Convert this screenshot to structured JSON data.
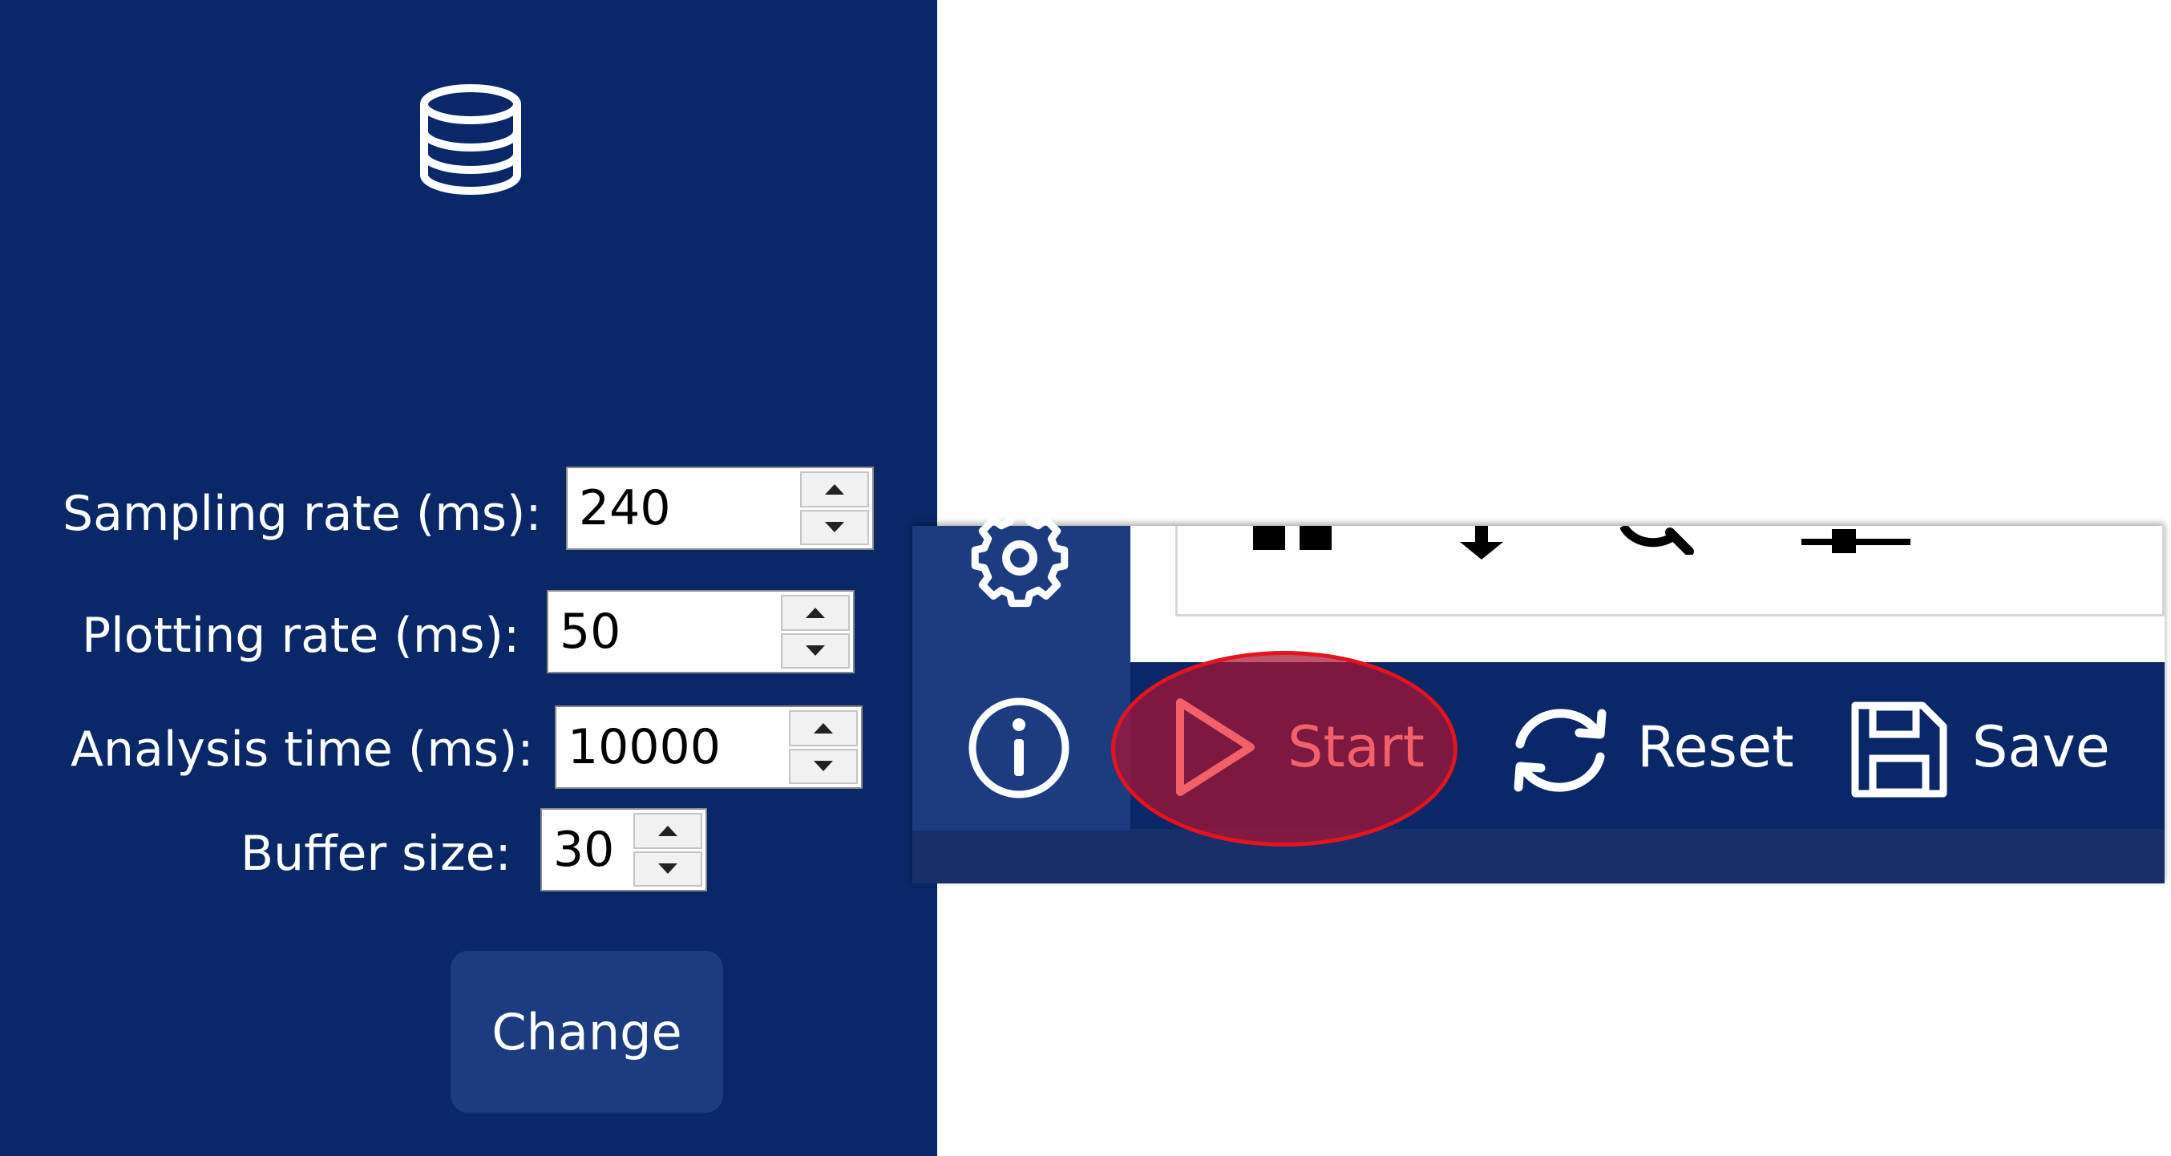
{
  "settings": {
    "fields": [
      {
        "label": "Sampling rate (ms):",
        "value": "240"
      },
      {
        "label": "Plotting rate (ms):",
        "value": "50"
      },
      {
        "label": "Analysis time (ms):",
        "value": "10000"
      },
      {
        "label": "Buffer size:",
        "value": "30"
      }
    ],
    "change_label": "Change"
  },
  "sidebar": {
    "icons": [
      "database-icon",
      "gear-icon",
      "info-icon"
    ]
  },
  "plot_toolbar": {
    "icons": [
      "pan-icon",
      "download-icon",
      "zoom-icon",
      "adjust-icon"
    ]
  },
  "actions": {
    "start_label": "Start",
    "reset_label": "Reset",
    "save_label": "Save"
  },
  "colors": {
    "panel_bg": "#0a2767",
    "highlight_ring": "#e3141f",
    "start_accent": "#f2606a"
  }
}
